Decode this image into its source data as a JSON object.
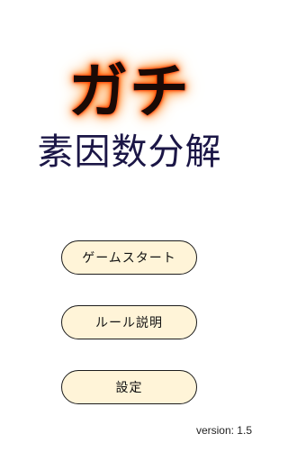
{
  "title": {
    "main": "ガチ",
    "sub": "素因数分解"
  },
  "menu": {
    "start_label": "ゲームスタート",
    "rules_label": "ルール説明",
    "settings_label": "設定"
  },
  "footer": {
    "version": "version: 1.5"
  },
  "colors": {
    "title_glow": "#ff5a00",
    "subtitle": "#1b1646",
    "button_fill": "#fff4d8",
    "button_border": "#1c1c1c"
  }
}
